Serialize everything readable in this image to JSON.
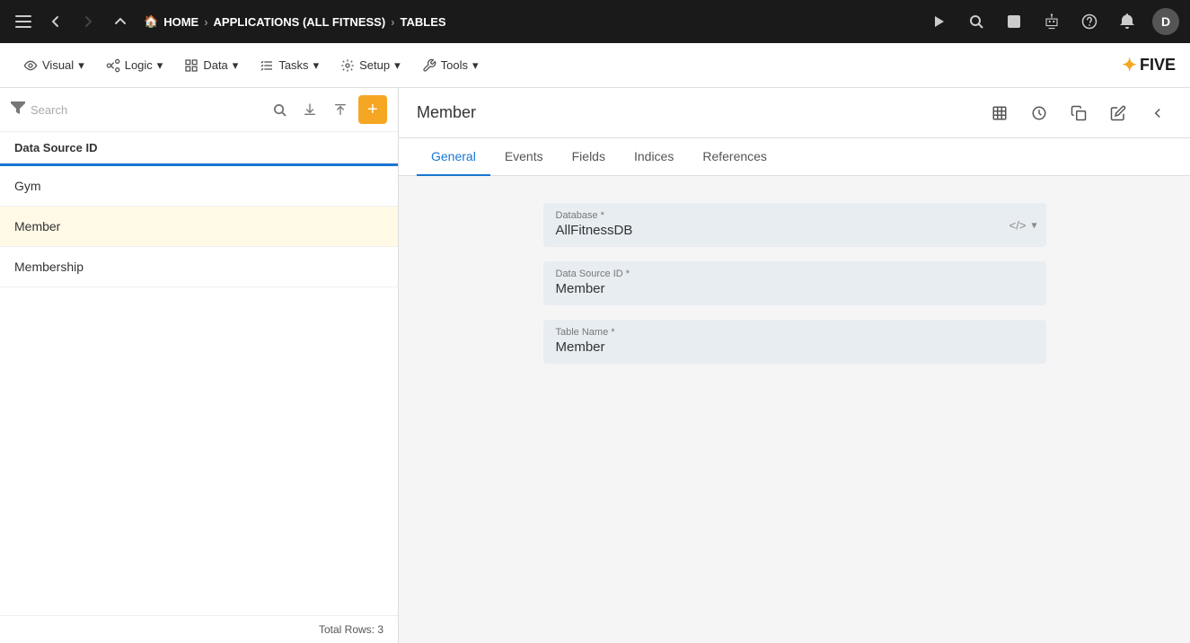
{
  "topnav": {
    "breadcrumbs": [
      {
        "label": "HOME",
        "icon": "home"
      },
      {
        "label": "APPLICATIONS (ALL FITNESS)"
      },
      {
        "label": "TABLES"
      }
    ],
    "actions": [
      "play",
      "search",
      "stop",
      "user-alien",
      "help",
      "bell",
      "user-avatar"
    ],
    "avatar_letter": "D"
  },
  "secondnav": {
    "items": [
      {
        "label": "Visual",
        "icon": "eye",
        "has_dropdown": true
      },
      {
        "label": "Logic",
        "icon": "flow",
        "has_dropdown": true
      },
      {
        "label": "Data",
        "icon": "grid",
        "has_dropdown": true
      },
      {
        "label": "Tasks",
        "icon": "tasks",
        "has_dropdown": true
      },
      {
        "label": "Setup",
        "icon": "gear",
        "has_dropdown": true
      },
      {
        "label": "Tools",
        "icon": "tools",
        "has_dropdown": true
      }
    ],
    "logo": "FIVE"
  },
  "sidebar": {
    "search_placeholder": "Search",
    "header": "Data Source ID",
    "items": [
      {
        "label": "Gym",
        "active": false
      },
      {
        "label": "Member",
        "active": true
      },
      {
        "label": "Membership",
        "active": false
      }
    ],
    "footer": "Total Rows: 3"
  },
  "content": {
    "title": "Member",
    "tabs": [
      {
        "label": "General",
        "active": true
      },
      {
        "label": "Events",
        "active": false
      },
      {
        "label": "Fields",
        "active": false
      },
      {
        "label": "Indices",
        "active": false
      },
      {
        "label": "References",
        "active": false
      }
    ],
    "form": {
      "database_label": "Database *",
      "database_value": "AllFitnessDB",
      "datasource_id_label": "Data Source ID *",
      "datasource_id_value": "Member",
      "table_name_label": "Table Name *",
      "table_name_value": "Member"
    }
  }
}
